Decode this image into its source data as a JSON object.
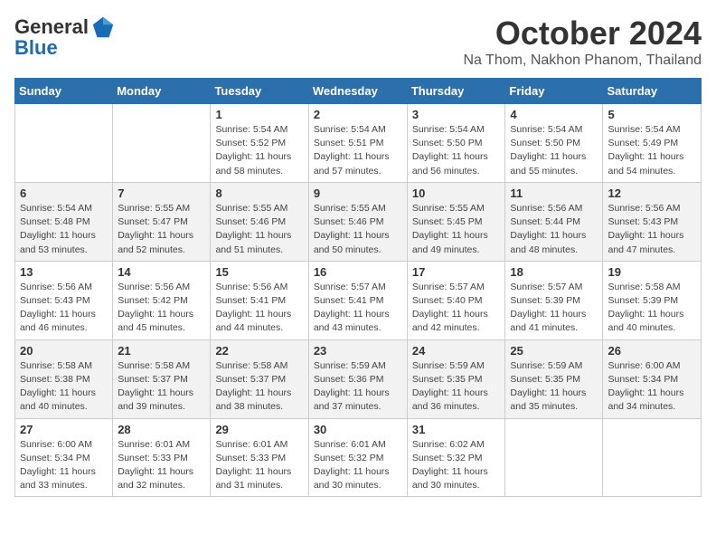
{
  "header": {
    "logo_general": "General",
    "logo_blue": "Blue",
    "month": "October 2024",
    "location": "Na Thom, Nakhon Phanom, Thailand"
  },
  "weekdays": [
    "Sunday",
    "Monday",
    "Tuesday",
    "Wednesday",
    "Thursday",
    "Friday",
    "Saturday"
  ],
  "weeks": [
    [
      {
        "day": "",
        "sunrise": "",
        "sunset": "",
        "daylight": ""
      },
      {
        "day": "",
        "sunrise": "",
        "sunset": "",
        "daylight": ""
      },
      {
        "day": "1",
        "sunrise": "Sunrise: 5:54 AM",
        "sunset": "Sunset: 5:52 PM",
        "daylight": "Daylight: 11 hours and 58 minutes."
      },
      {
        "day": "2",
        "sunrise": "Sunrise: 5:54 AM",
        "sunset": "Sunset: 5:51 PM",
        "daylight": "Daylight: 11 hours and 57 minutes."
      },
      {
        "day": "3",
        "sunrise": "Sunrise: 5:54 AM",
        "sunset": "Sunset: 5:50 PM",
        "daylight": "Daylight: 11 hours and 56 minutes."
      },
      {
        "day": "4",
        "sunrise": "Sunrise: 5:54 AM",
        "sunset": "Sunset: 5:50 PM",
        "daylight": "Daylight: 11 hours and 55 minutes."
      },
      {
        "day": "5",
        "sunrise": "Sunrise: 5:54 AM",
        "sunset": "Sunset: 5:49 PM",
        "daylight": "Daylight: 11 hours and 54 minutes."
      }
    ],
    [
      {
        "day": "6",
        "sunrise": "Sunrise: 5:54 AM",
        "sunset": "Sunset: 5:48 PM",
        "daylight": "Daylight: 11 hours and 53 minutes."
      },
      {
        "day": "7",
        "sunrise": "Sunrise: 5:55 AM",
        "sunset": "Sunset: 5:47 PM",
        "daylight": "Daylight: 11 hours and 52 minutes."
      },
      {
        "day": "8",
        "sunrise": "Sunrise: 5:55 AM",
        "sunset": "Sunset: 5:46 PM",
        "daylight": "Daylight: 11 hours and 51 minutes."
      },
      {
        "day": "9",
        "sunrise": "Sunrise: 5:55 AM",
        "sunset": "Sunset: 5:46 PM",
        "daylight": "Daylight: 11 hours and 50 minutes."
      },
      {
        "day": "10",
        "sunrise": "Sunrise: 5:55 AM",
        "sunset": "Sunset: 5:45 PM",
        "daylight": "Daylight: 11 hours and 49 minutes."
      },
      {
        "day": "11",
        "sunrise": "Sunrise: 5:56 AM",
        "sunset": "Sunset: 5:44 PM",
        "daylight": "Daylight: 11 hours and 48 minutes."
      },
      {
        "day": "12",
        "sunrise": "Sunrise: 5:56 AM",
        "sunset": "Sunset: 5:43 PM",
        "daylight": "Daylight: 11 hours and 47 minutes."
      }
    ],
    [
      {
        "day": "13",
        "sunrise": "Sunrise: 5:56 AM",
        "sunset": "Sunset: 5:43 PM",
        "daylight": "Daylight: 11 hours and 46 minutes."
      },
      {
        "day": "14",
        "sunrise": "Sunrise: 5:56 AM",
        "sunset": "Sunset: 5:42 PM",
        "daylight": "Daylight: 11 hours and 45 minutes."
      },
      {
        "day": "15",
        "sunrise": "Sunrise: 5:56 AM",
        "sunset": "Sunset: 5:41 PM",
        "daylight": "Daylight: 11 hours and 44 minutes."
      },
      {
        "day": "16",
        "sunrise": "Sunrise: 5:57 AM",
        "sunset": "Sunset: 5:41 PM",
        "daylight": "Daylight: 11 hours and 43 minutes."
      },
      {
        "day": "17",
        "sunrise": "Sunrise: 5:57 AM",
        "sunset": "Sunset: 5:40 PM",
        "daylight": "Daylight: 11 hours and 42 minutes."
      },
      {
        "day": "18",
        "sunrise": "Sunrise: 5:57 AM",
        "sunset": "Sunset: 5:39 PM",
        "daylight": "Daylight: 11 hours and 41 minutes."
      },
      {
        "day": "19",
        "sunrise": "Sunrise: 5:58 AM",
        "sunset": "Sunset: 5:39 PM",
        "daylight": "Daylight: 11 hours and 40 minutes."
      }
    ],
    [
      {
        "day": "20",
        "sunrise": "Sunrise: 5:58 AM",
        "sunset": "Sunset: 5:38 PM",
        "daylight": "Daylight: 11 hours and 40 minutes."
      },
      {
        "day": "21",
        "sunrise": "Sunrise: 5:58 AM",
        "sunset": "Sunset: 5:37 PM",
        "daylight": "Daylight: 11 hours and 39 minutes."
      },
      {
        "day": "22",
        "sunrise": "Sunrise: 5:58 AM",
        "sunset": "Sunset: 5:37 PM",
        "daylight": "Daylight: 11 hours and 38 minutes."
      },
      {
        "day": "23",
        "sunrise": "Sunrise: 5:59 AM",
        "sunset": "Sunset: 5:36 PM",
        "daylight": "Daylight: 11 hours and 37 minutes."
      },
      {
        "day": "24",
        "sunrise": "Sunrise: 5:59 AM",
        "sunset": "Sunset: 5:35 PM",
        "daylight": "Daylight: 11 hours and 36 minutes."
      },
      {
        "day": "25",
        "sunrise": "Sunrise: 5:59 AM",
        "sunset": "Sunset: 5:35 PM",
        "daylight": "Daylight: 11 hours and 35 minutes."
      },
      {
        "day": "26",
        "sunrise": "Sunrise: 6:00 AM",
        "sunset": "Sunset: 5:34 PM",
        "daylight": "Daylight: 11 hours and 34 minutes."
      }
    ],
    [
      {
        "day": "27",
        "sunrise": "Sunrise: 6:00 AM",
        "sunset": "Sunset: 5:34 PM",
        "daylight": "Daylight: 11 hours and 33 minutes."
      },
      {
        "day": "28",
        "sunrise": "Sunrise: 6:01 AM",
        "sunset": "Sunset: 5:33 PM",
        "daylight": "Daylight: 11 hours and 32 minutes."
      },
      {
        "day": "29",
        "sunrise": "Sunrise: 6:01 AM",
        "sunset": "Sunset: 5:33 PM",
        "daylight": "Daylight: 11 hours and 31 minutes."
      },
      {
        "day": "30",
        "sunrise": "Sunrise: 6:01 AM",
        "sunset": "Sunset: 5:32 PM",
        "daylight": "Daylight: 11 hours and 30 minutes."
      },
      {
        "day": "31",
        "sunrise": "Sunrise: 6:02 AM",
        "sunset": "Sunset: 5:32 PM",
        "daylight": "Daylight: 11 hours and 30 minutes."
      },
      {
        "day": "",
        "sunrise": "",
        "sunset": "",
        "daylight": ""
      },
      {
        "day": "",
        "sunrise": "",
        "sunset": "",
        "daylight": ""
      }
    ]
  ]
}
